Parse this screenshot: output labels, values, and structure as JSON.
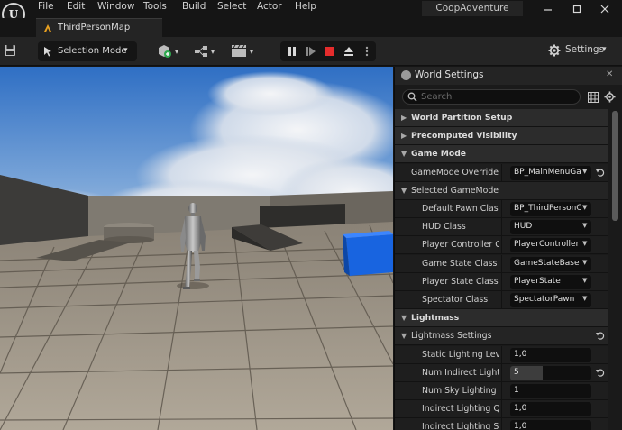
{
  "menubar": {
    "items": [
      "File",
      "Edit",
      "Window",
      "Tools",
      "Build",
      "Select",
      "Actor",
      "Help"
    ],
    "project_name": "CoopAdventure",
    "logo_icon": "unreal-logo-icon",
    "window_controls": [
      "minimize",
      "maximize",
      "close"
    ]
  },
  "tabs": [
    {
      "label": "ThirdPersonMap",
      "icon": "level-map-icon",
      "active": true
    }
  ],
  "toolbar": {
    "save_icon": "save-icon",
    "selection_mode_label": "Selection Mode",
    "add_icon": "add-actor-icon",
    "blueprint_icon": "blueprint-icon",
    "cinematics_icon": "cinematics-icon",
    "play_controls": [
      "pause",
      "skip-frame",
      "stop",
      "eject",
      "more-options"
    ],
    "stop_color": "#e52c2c",
    "settings_label": "Settings"
  },
  "panel": {
    "title": "World Settings",
    "search_placeholder": "Search",
    "rows": [
      {
        "type": "cat",
        "label": "World Partition Setup",
        "expanded": false
      },
      {
        "type": "cat",
        "label": "Precomputed Visibility",
        "expanded": false
      },
      {
        "type": "cat",
        "label": "Game Mode",
        "expanded": true
      },
      {
        "type": "prop1",
        "label": "GameMode Override",
        "combo": "BP_MainMenuGameMode",
        "reset": true
      },
      {
        "type": "sub",
        "label": "Selected GameMode",
        "expanded": true
      },
      {
        "type": "prop",
        "label": "Default Pawn Class",
        "combo": "BP_ThirdPersonCharacter"
      },
      {
        "type": "prop",
        "label": "HUD Class",
        "combo": "HUD"
      },
      {
        "type": "prop",
        "label": "Player Controller Class",
        "combo": "PlayerController"
      },
      {
        "type": "prop",
        "label": "Game State Class",
        "combo": "GameStateBase"
      },
      {
        "type": "prop",
        "label": "Player State Class",
        "combo": "PlayerState"
      },
      {
        "type": "prop",
        "label": "Spectator Class",
        "combo": "SpectatorPawn"
      },
      {
        "type": "cat",
        "label": "Lightmass",
        "expanded": true
      },
      {
        "type": "sub",
        "label": "Lightmass Settings",
        "expanded": true,
        "reset": true
      },
      {
        "type": "prop",
        "label": "Static Lighting Level Scale",
        "value": "1,0"
      },
      {
        "type": "prop",
        "label": "Num Indirect Lighting Bounces",
        "value": "5",
        "fill_fraction": 0.4,
        "reset": true
      },
      {
        "type": "prop",
        "label": "Num Sky Lighting Bounces",
        "value": "1"
      },
      {
        "type": "prop",
        "label": "Indirect Lighting Quality",
        "value": "1,0"
      },
      {
        "type": "prop",
        "label": "Indirect Lighting Smoothness",
        "value": "1,0"
      }
    ]
  }
}
